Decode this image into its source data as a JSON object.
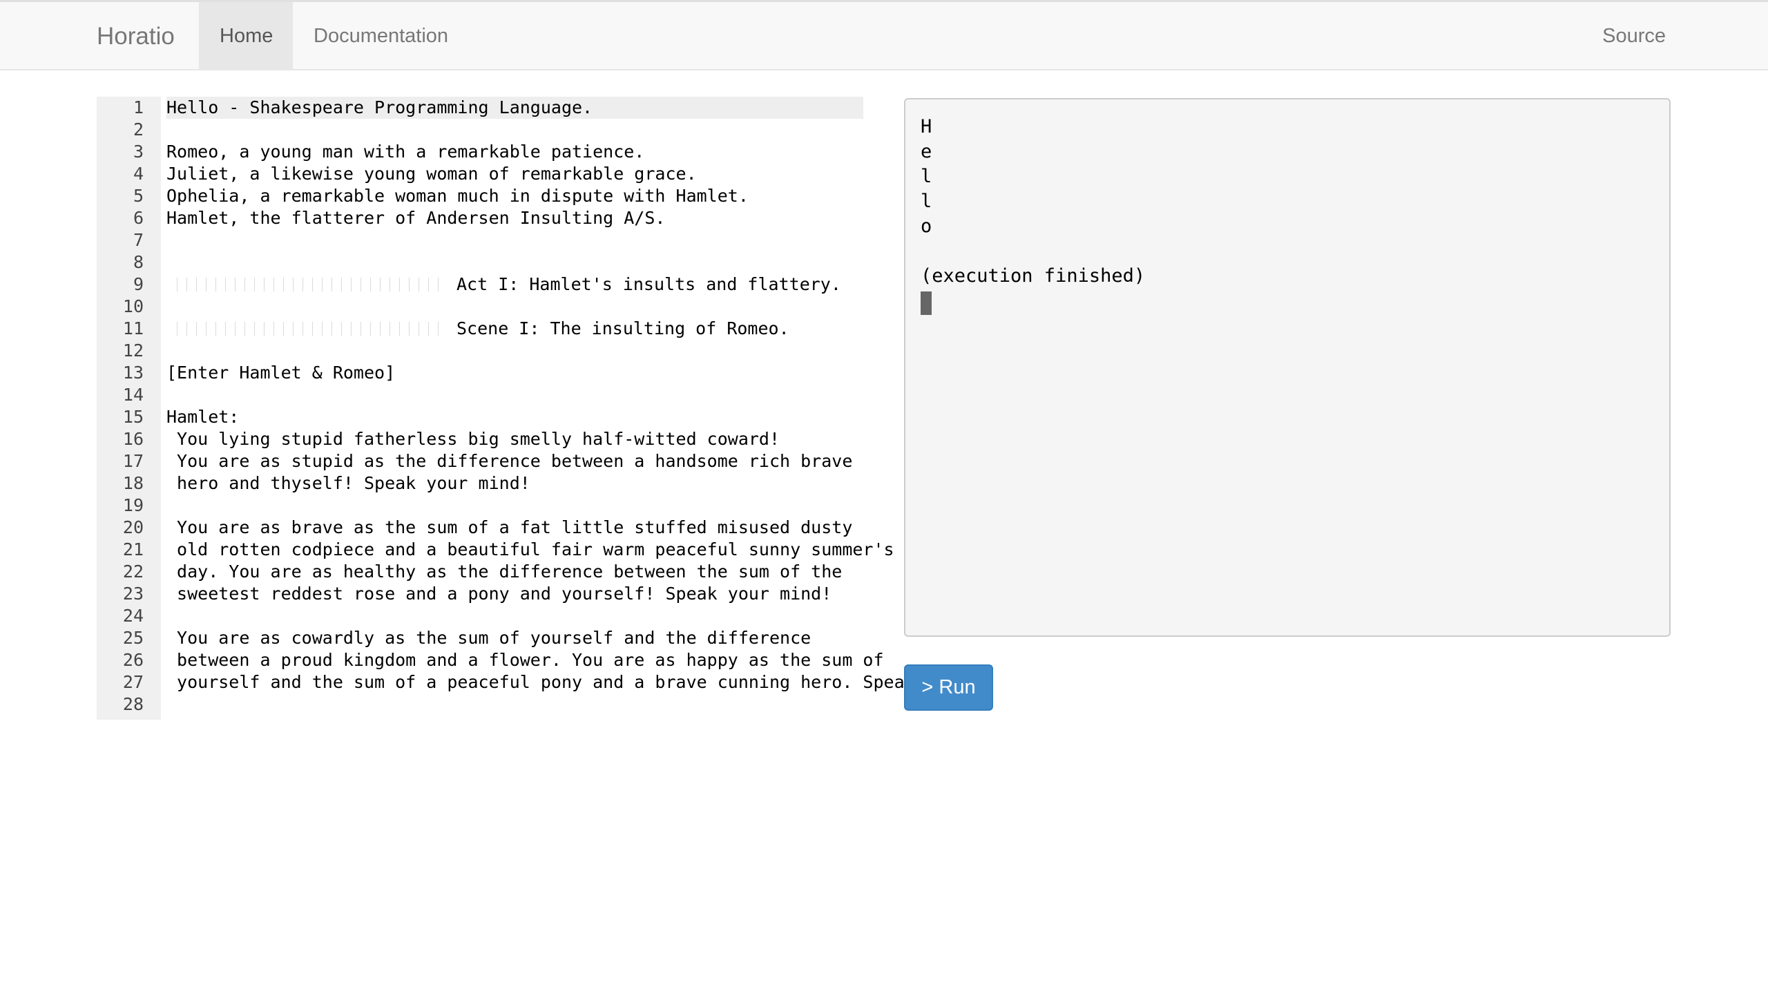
{
  "nav": {
    "brand": "Horatio",
    "home": "Home",
    "documentation": "Documentation",
    "source": "Source"
  },
  "editor": {
    "lines": [
      {
        "n": "1",
        "text": "Hello - Shakespeare Programming Language."
      },
      {
        "n": "2",
        "text": ""
      },
      {
        "n": "3",
        "text": "Romeo, a young man with a remarkable patience."
      },
      {
        "n": "4",
        "text": "Juliet, a likewise young woman of remarkable grace."
      },
      {
        "n": "5",
        "text": "Ophelia, a remarkable woman much in dispute with Hamlet."
      },
      {
        "n": "6",
        "text": "Hamlet, the flatterer of Andersen Insulting A/S."
      },
      {
        "n": "7",
        "text": ""
      },
      {
        "n": "8",
        "text": ""
      },
      {
        "n": "9",
        "text": "Act I: Hamlet's insults and flattery."
      },
      {
        "n": "10",
        "text": ""
      },
      {
        "n": "11",
        "text": "Scene I: The insulting of Romeo."
      },
      {
        "n": "12",
        "text": ""
      },
      {
        "n": "13",
        "text": "[Enter Hamlet & Romeo]"
      },
      {
        "n": "14",
        "text": ""
      },
      {
        "n": "15",
        "text": "Hamlet:"
      },
      {
        "n": "16",
        "text": " You lying stupid fatherless big smelly half-witted coward!"
      },
      {
        "n": "17",
        "text": " You are as stupid as the difference between a handsome rich brave"
      },
      {
        "n": "18",
        "text": " hero and thyself! Speak your mind!"
      },
      {
        "n": "19",
        "text": ""
      },
      {
        "n": "20",
        "text": " You are as brave as the sum of a fat little stuffed misused dusty"
      },
      {
        "n": "21",
        "text": " old rotten codpiece and a beautiful fair warm peaceful sunny summer's"
      },
      {
        "n": "22",
        "text": " day. You are as healthy as the difference between the sum of the"
      },
      {
        "n": "23",
        "text": " sweetest reddest rose and a pony and yourself! Speak your mind!"
      },
      {
        "n": "24",
        "text": ""
      },
      {
        "n": "25",
        "text": " You are as cowardly as the sum of yourself and the difference"
      },
      {
        "n": "26",
        "text": " between a proud kingdom and a flower. You are as happy as the sum of"
      },
      {
        "n": "27",
        "text": " yourself and the sum of a peaceful pony and a brave cunning hero. Speak"
      },
      {
        "n": "28",
        "text": ""
      }
    ]
  },
  "output": {
    "lines": [
      "H",
      "e",
      "l",
      "l",
      "o",
      "",
      "(execution finished)"
    ]
  },
  "run_button": "> Run"
}
